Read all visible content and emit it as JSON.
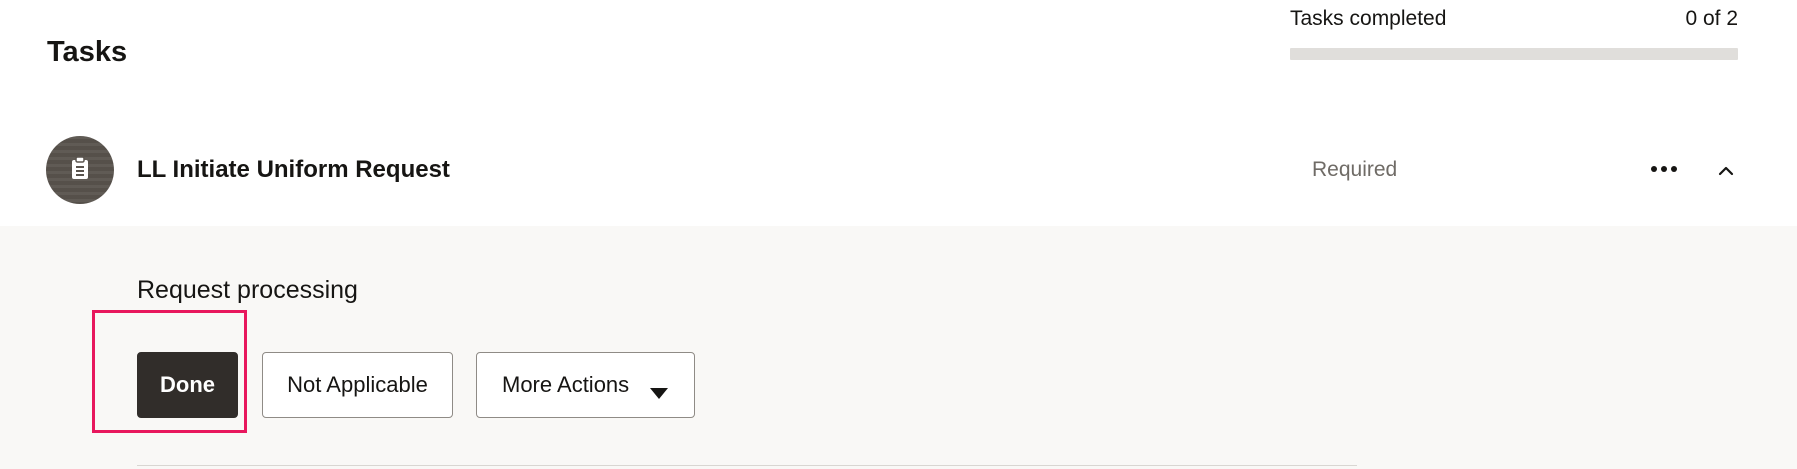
{
  "header": {
    "title": "Tasks"
  },
  "progress": {
    "label": "Tasks completed",
    "count_text": "0 of 2",
    "completed": 0,
    "total": 2,
    "fraction": 0
  },
  "task": {
    "name": "LL Initiate Uniform Request",
    "status": "Required",
    "avatar_icon": "clipboard-icon",
    "more_icon": "ellipsis-icon",
    "collapse_icon": "chevron-up-icon",
    "expanded": true
  },
  "panel": {
    "description": "Request processing",
    "buttons": {
      "done": "Done",
      "not_applicable": "Not Applicable",
      "more_actions": "More Actions"
    },
    "more_actions_icon": "caret-down-icon"
  },
  "colors": {
    "highlight": "#e8175d",
    "primary_button": "#312d2a",
    "panel_background": "#f9f8f6",
    "progress_track": "#e0dedb"
  }
}
